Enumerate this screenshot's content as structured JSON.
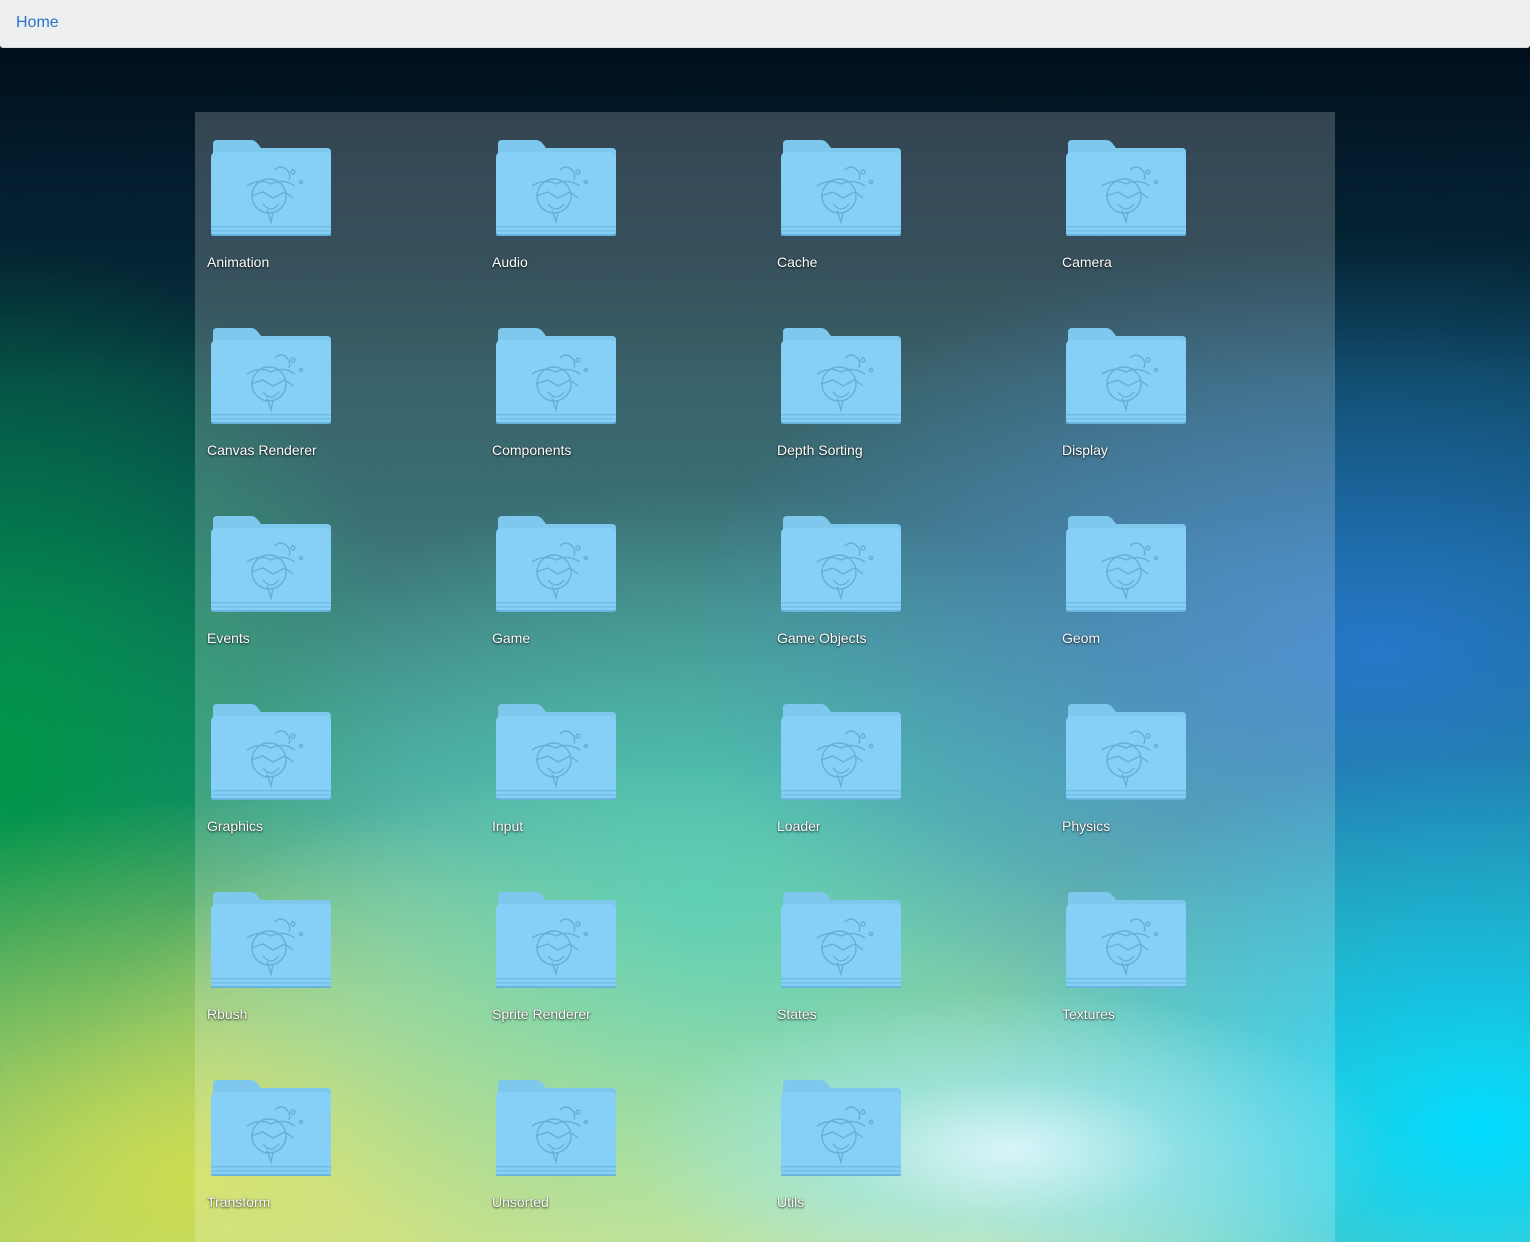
{
  "navbar": {
    "home_label": "Home"
  },
  "folder_icon": "folder-icon",
  "folders": [
    {
      "label": "Animation"
    },
    {
      "label": "Audio"
    },
    {
      "label": "Cache"
    },
    {
      "label": "Camera"
    },
    {
      "label": "Canvas Renderer"
    },
    {
      "label": "Components"
    },
    {
      "label": "Depth Sorting"
    },
    {
      "label": "Display"
    },
    {
      "label": "Events"
    },
    {
      "label": "Game"
    },
    {
      "label": "Game Objects"
    },
    {
      "label": "Geom"
    },
    {
      "label": "Graphics"
    },
    {
      "label": "Input"
    },
    {
      "label": "Loader"
    },
    {
      "label": "Physics"
    },
    {
      "label": "Rbush"
    },
    {
      "label": "Sprite Renderer"
    },
    {
      "label": "States"
    },
    {
      "label": "Textures"
    },
    {
      "label": "Transform"
    },
    {
      "label": "Unsorted"
    },
    {
      "label": "Utils"
    }
  ],
  "colors": {
    "navbar_bg": "#eceef0",
    "link": "#2a74c5",
    "folder_body": "#7dcdf6",
    "folder_tab": "#9ad9f9",
    "label_text": "#ffffff"
  }
}
